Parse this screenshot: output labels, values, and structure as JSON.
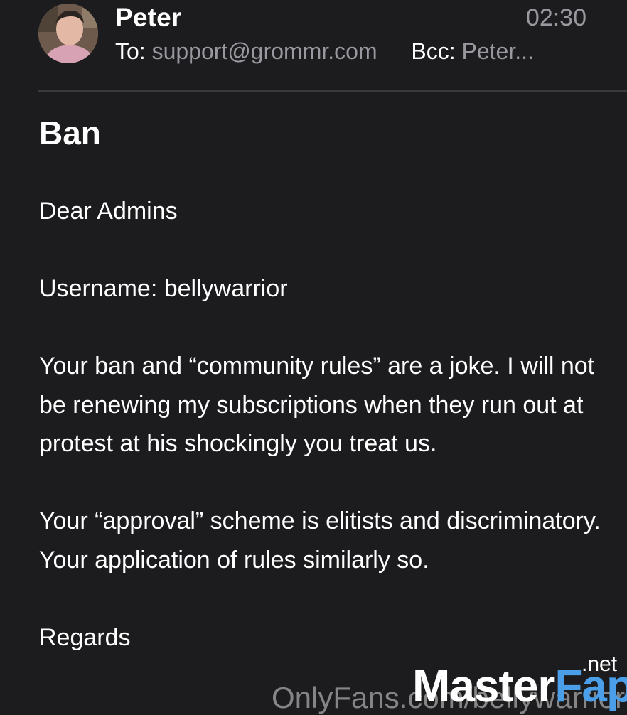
{
  "email": {
    "sender": "Peter",
    "time": "02:30",
    "to_label": "To:",
    "to_address": "support@grommr.com",
    "bcc_label": "Bcc:",
    "bcc_address": "Peter...",
    "subject": "Ban",
    "paragraphs": [
      "Dear Admins",
      "Username: bellywarrior",
      "Your ban and “community rules” are a joke. I will not be renewing my subscriptions when they run out at protest at his shockingly you treat us.",
      "Your “approval” scheme is elitists and discriminatory. Your application of rules similarly so.",
      "Regards"
    ]
  },
  "watermarks": {
    "onlyfans": "OnlyFans.com/bellywarrior",
    "masterfap_a": "Master",
    "masterfap_b": "Fap",
    "masterfap_tld": ".net"
  }
}
